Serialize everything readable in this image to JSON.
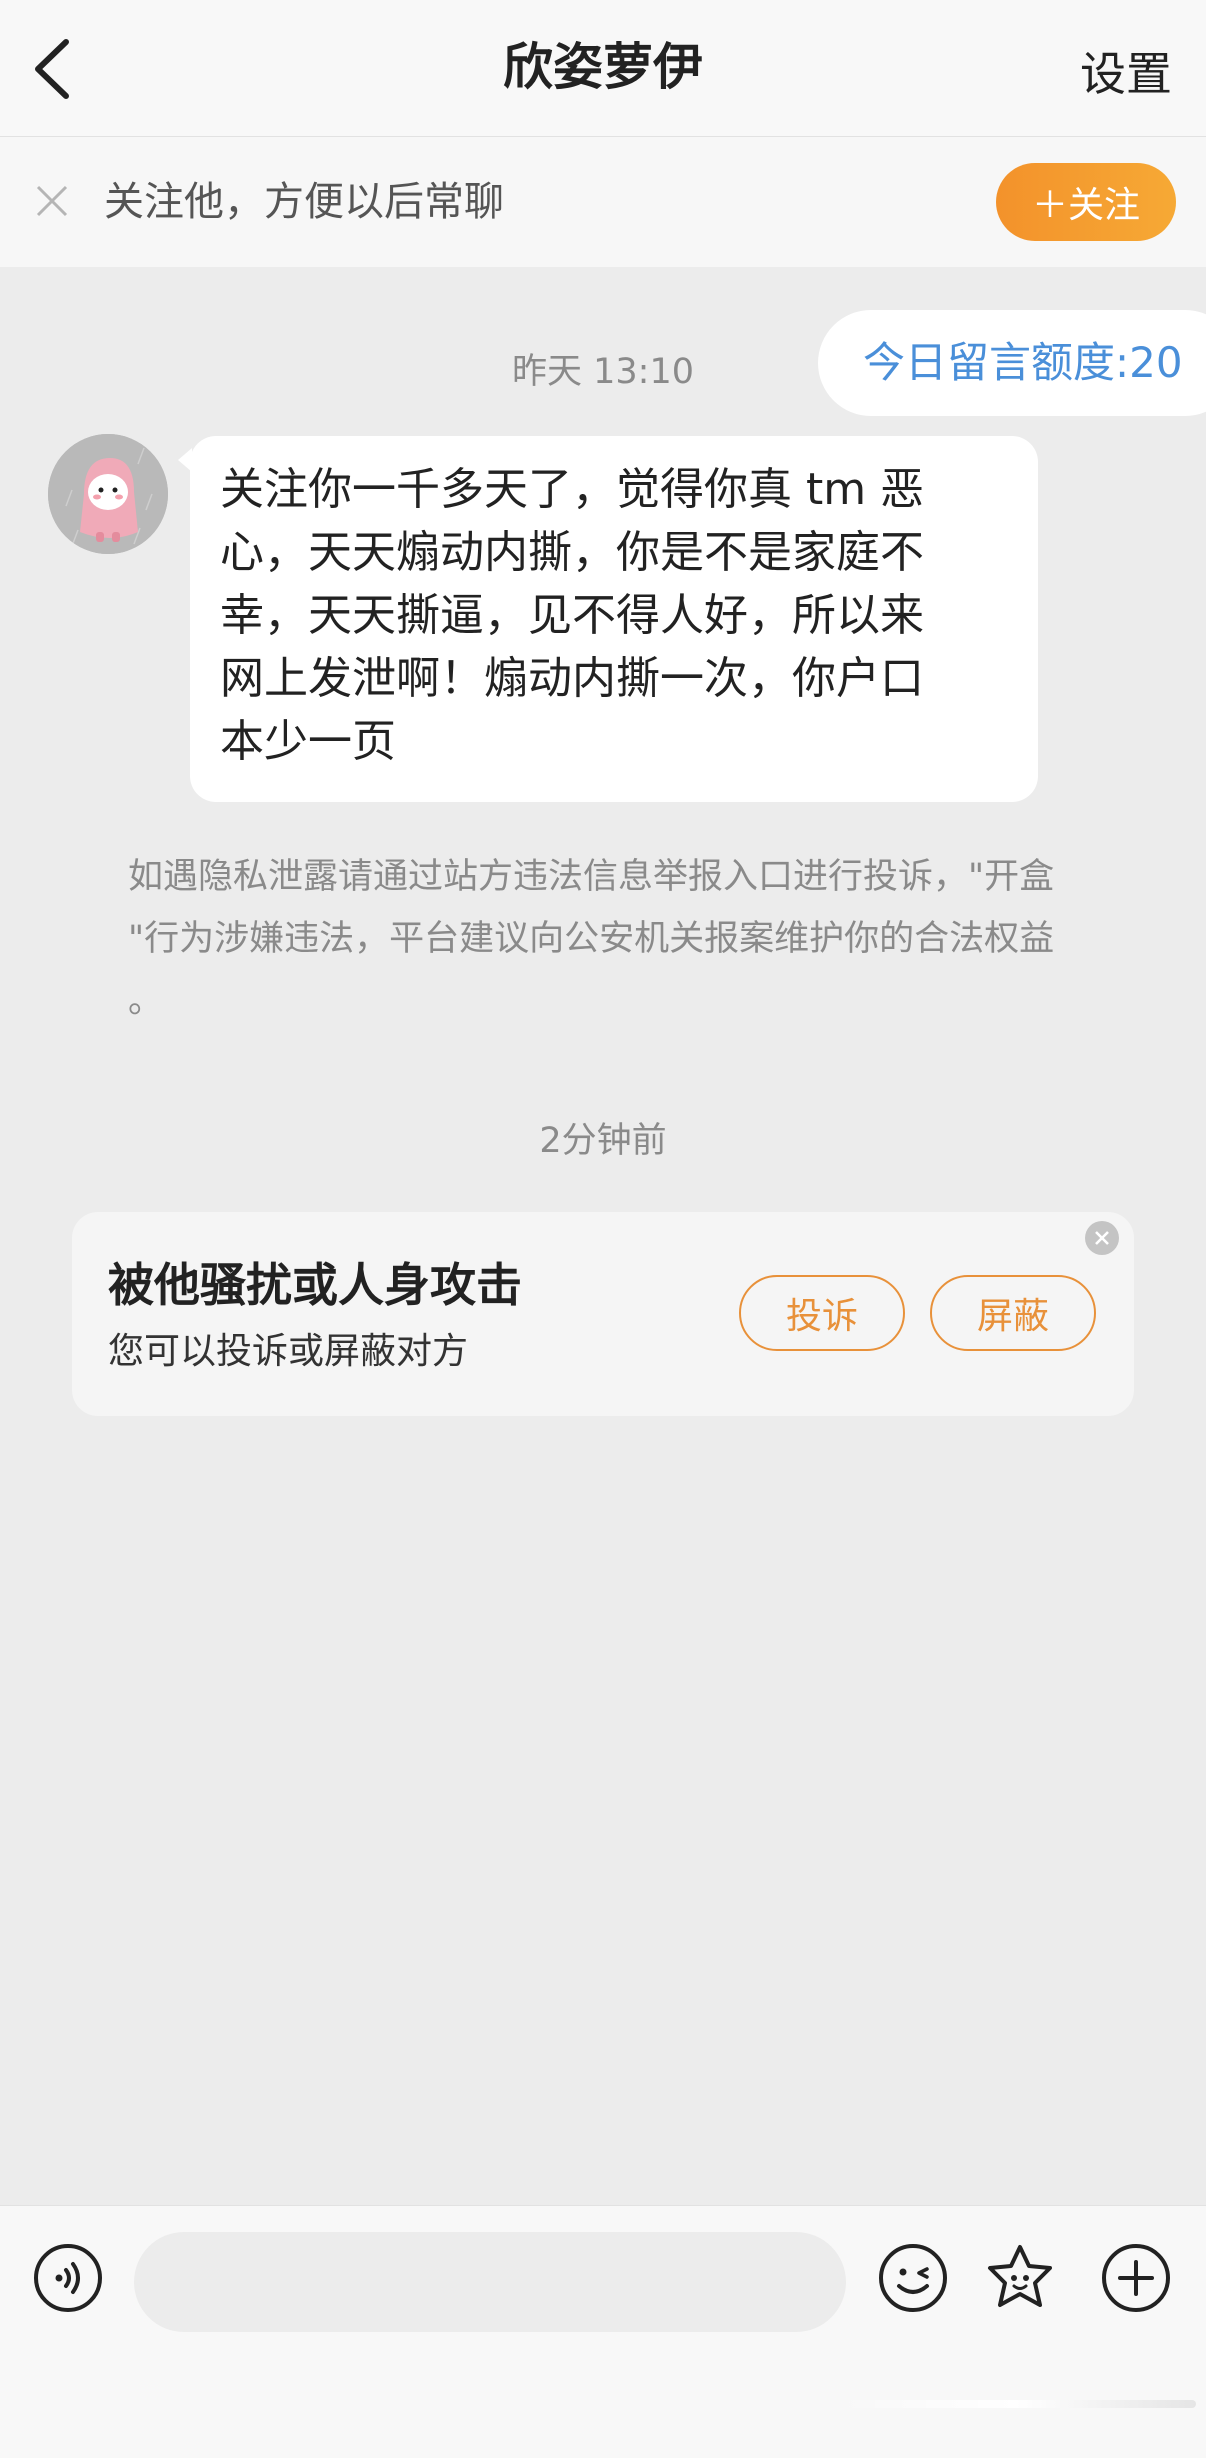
{
  "header": {
    "title": "欣姿萝伊",
    "settings_label": "设置",
    "back_icon": "chevron-left-icon"
  },
  "follow_bar": {
    "text": "关注他，方便以后常聊",
    "button_label": "＋关注",
    "close_icon": "close-icon"
  },
  "quota": {
    "label": "今日留言额度:20"
  },
  "messages": [
    {
      "time": "昨天 13:10",
      "lines": [
        "关注你一千多天了，觉得你真 tm 恶",
        "心，天天煽动内撕，你是不是家庭不",
        "幸，天天撕逼，见不得人好，所以来",
        "网上发泄啊！煽动内撕一次，你户口",
        "本少一页"
      ]
    }
  ],
  "notice": {
    "lines": [
      "如遇隐私泄露请通过站方违法信息举报入口进行投诉，\"开盒",
      "\"行为涉嫌违法，平台建议向公安机关报案维护你的合法权益",
      "。"
    ]
  },
  "time_2": "2分钟前",
  "harassment_card": {
    "title": "被他骚扰或人身攻击",
    "subtitle": "您可以投诉或屏蔽对方",
    "report_label": "投诉",
    "block_label": "屏蔽"
  },
  "bottom_bar": {
    "input_value": "",
    "icons": [
      "voice-icon",
      "emoji-icon",
      "sticker-icon",
      "plus-icon"
    ]
  },
  "colors": {
    "accent_orange": "#f3922b",
    "quota_blue": "#4a8fd9",
    "background": "#ececec"
  }
}
